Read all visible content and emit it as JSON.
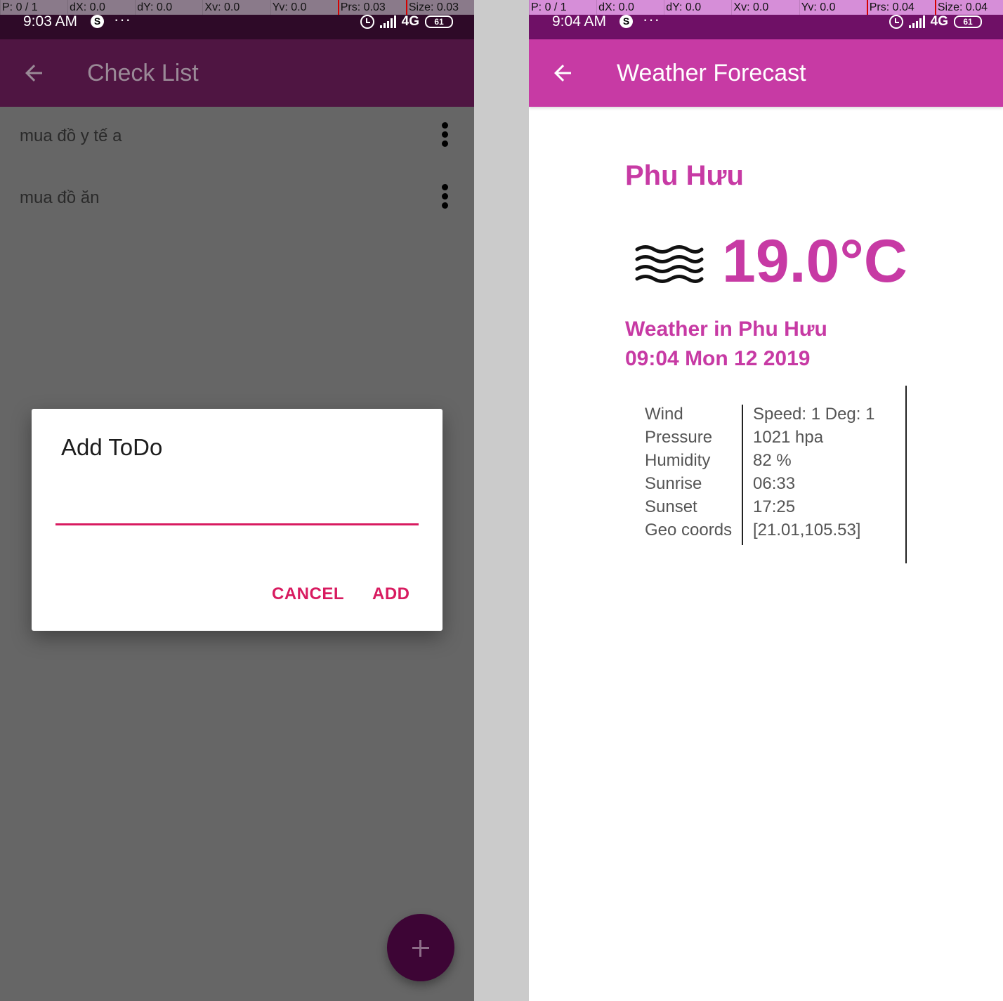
{
  "left": {
    "pointer": {
      "p": "P: 0 / 1",
      "dx": "dX: 0.0",
      "dy": "dY: 0.0",
      "xv": "Xv: 0.0",
      "yv": "Yv: 0.0",
      "prs": "Prs: 0.03",
      "size": "Size: 0.03"
    },
    "status": {
      "time": "9:03 AM",
      "s_badge": "S",
      "dots": "···",
      "network": "4G",
      "battery": "61"
    },
    "app_bar": {
      "title": "Check List",
      "back_icon": "arrow-back-icon"
    },
    "todos": [
      {
        "text": "mua đồ y tế a",
        "menu_icon": "more-vert-icon"
      },
      {
        "text": "mua đồ ăn",
        "menu_icon": "more-vert-icon"
      }
    ],
    "dialog": {
      "title": "Add ToDo",
      "input_value": "",
      "cancel_label": "CANCEL",
      "add_label": "ADD"
    },
    "fab": {
      "icon": "plus-icon"
    }
  },
  "right": {
    "pointer": {
      "p": "P: 0 / 1",
      "dx": "dX: 0.0",
      "dy": "dY: 0.0",
      "xv": "Xv: 0.0",
      "yv": "Yv: 0.0",
      "prs": "Prs: 0.04",
      "size": "Size: 0.04"
    },
    "status": {
      "time": "9:04 AM",
      "s_badge": "S",
      "dots": "···",
      "network": "4G",
      "battery": "61"
    },
    "app_bar": {
      "title": "Weather Forecast",
      "back_icon": "arrow-back-icon"
    },
    "weather": {
      "city": "Phu Hưu",
      "icon": "mist-icon",
      "temperature": "19.0°C",
      "weather_in": "Weather in Phu Hưu",
      "datetime": "09:04 Mon 12 2019",
      "details": [
        {
          "label": "Wind",
          "value": "Speed: 1 Deg: 1"
        },
        {
          "label": "Pressure",
          "value": "1021 hpa"
        },
        {
          "label": "Humidity",
          "value": "82 %"
        },
        {
          "label": "Sunrise",
          "value": "06:33"
        },
        {
          "label": "Sunset",
          "value": "17:25"
        },
        {
          "label": "Geo coords",
          "value": "[21.01,105.53]"
        }
      ]
    }
  },
  "colors": {
    "accent": "#d81b60",
    "weather_primary": "#c73aa4",
    "checklist_appbar": "#4f1542",
    "fab": "#3d0535"
  }
}
